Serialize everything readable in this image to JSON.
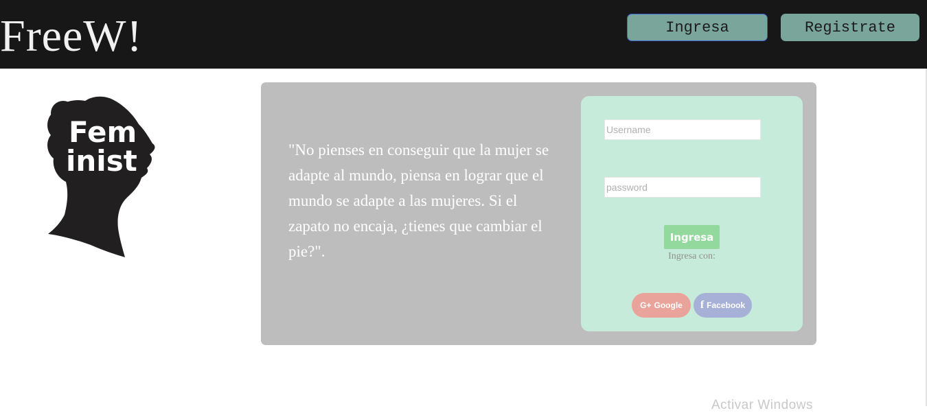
{
  "header": {
    "brand": "FreeW!",
    "login_label": "Ingresa",
    "register_label": "Registrate"
  },
  "logo": {
    "text_line1": "Fem",
    "text_line2": "inist"
  },
  "quote": {
    "text": "\"No pienses en conseguir que la mujer se adapte al mundo, piensa en lograr que el mundo se adapte a las mujeres. Si el zapato no encaja, ¿tienes que cambiar el pie?\"."
  },
  "login_form": {
    "username_placeholder": "Username",
    "password_placeholder": "password",
    "submit_label": "Ingresa",
    "with_label": "Ingresa con:",
    "google_icon": "G+",
    "google_label": "Google",
    "facebook_icon": "f",
    "facebook_label": "Facebook"
  },
  "watermark": {
    "text": "Activar Windows"
  },
  "colors": {
    "header_bg": "#171717",
    "nav_button": "#7aa59a",
    "panel_bg": "#bdbdbd",
    "card_bg": "#c7ebda",
    "submit_bg": "#93d89c",
    "google": "#eaa39b",
    "facebook": "#a7b1d8"
  }
}
